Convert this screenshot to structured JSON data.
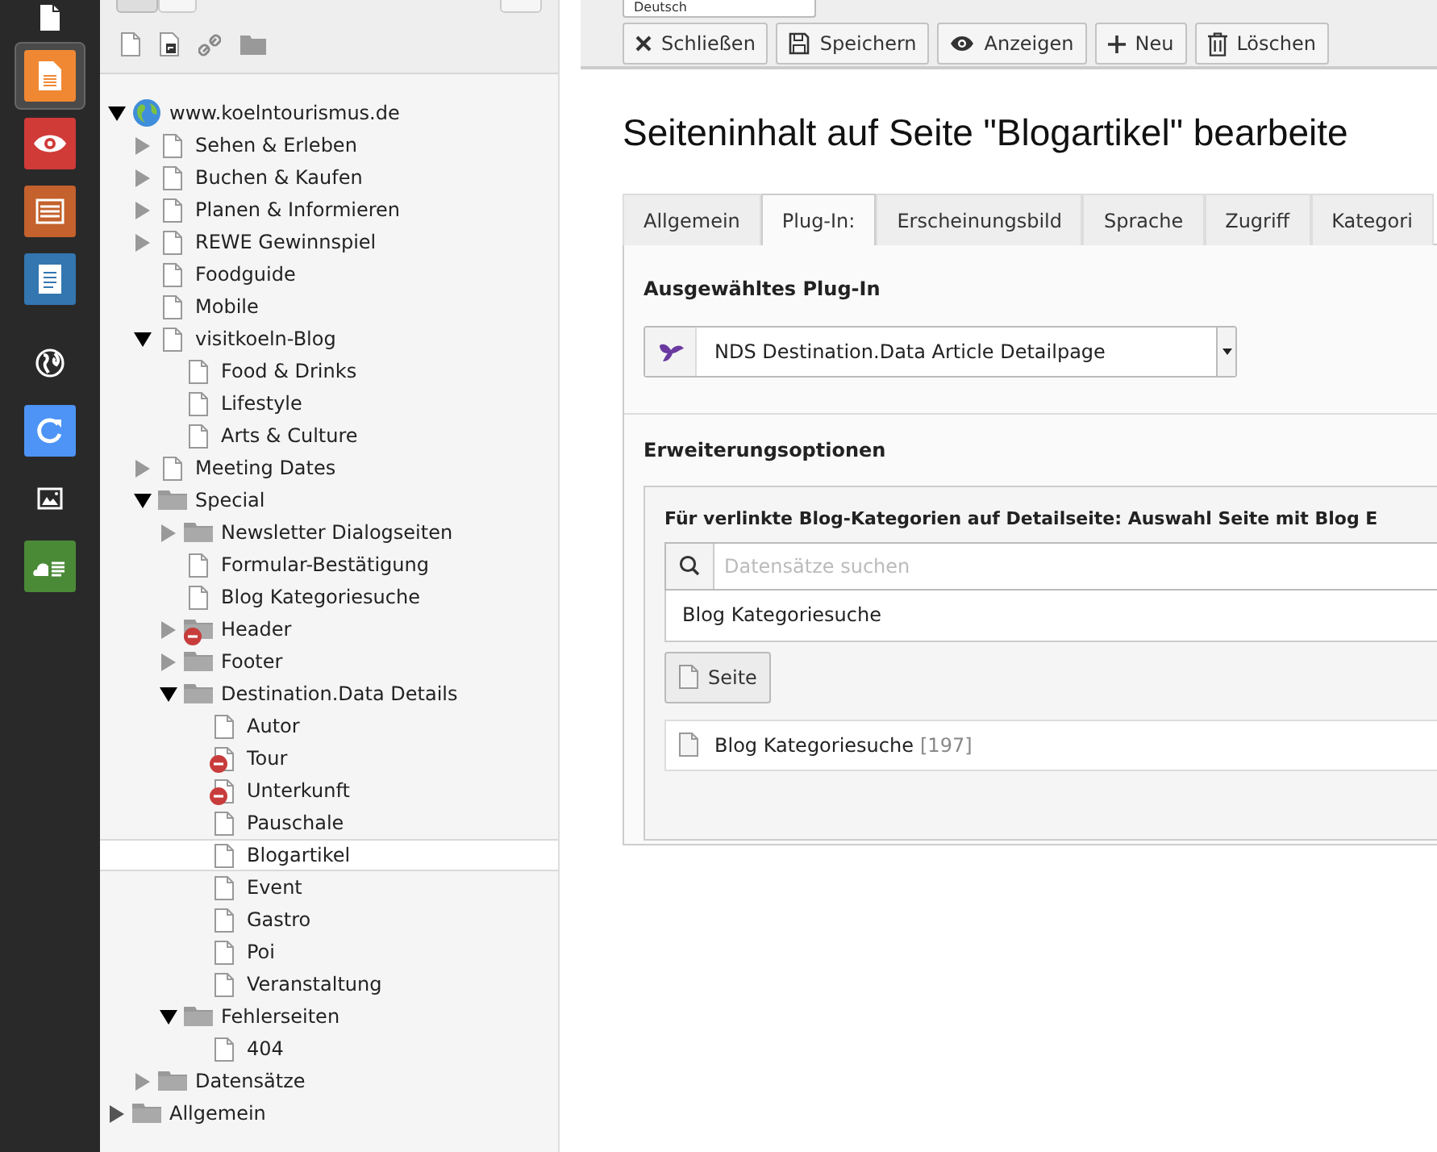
{
  "modules": [
    {
      "kind": "page",
      "selected": false
    },
    {
      "kind": "page-lines",
      "color": "#f08833",
      "selected": true
    },
    {
      "kind": "eye",
      "color": "#d03a37",
      "selected": false
    },
    {
      "kind": "list",
      "color": "#c4612d",
      "selected": false
    },
    {
      "kind": "document",
      "color": "#3376b0",
      "selected": false
    },
    {
      "kind": "globe",
      "selected": false
    },
    {
      "kind": "refresh",
      "color": "#4d94f6",
      "selected": false
    },
    {
      "kind": "image",
      "selected": false
    },
    {
      "kind": "cloud",
      "color": "#4a8a37",
      "selected": false
    }
  ],
  "tree": [
    {
      "label": "www.koelntourismus.de",
      "kind": "site",
      "expanded": true,
      "selected": false,
      "children": [
        {
          "label": "Sehen & Erleben",
          "kind": "page",
          "expanded": false,
          "selected": false
        },
        {
          "label": "Buchen & Kaufen",
          "kind": "page",
          "expanded": false,
          "selected": false
        },
        {
          "label": "Planen & Informieren",
          "kind": "page",
          "expanded": false,
          "selected": false
        },
        {
          "label": "REWE Gewinnspiel",
          "kind": "page",
          "expanded": false,
          "selected": false
        },
        {
          "label": "Foodguide",
          "kind": "page",
          "selected": false
        },
        {
          "label": "Mobile",
          "kind": "page",
          "selected": false
        },
        {
          "label": "visitkoeln-Blog",
          "kind": "page",
          "expanded": true,
          "selected": false,
          "children": [
            {
              "label": "Food & Drinks",
              "kind": "page",
              "selected": false
            },
            {
              "label": "Lifestyle",
              "kind": "page",
              "selected": false
            },
            {
              "label": "Arts & Culture",
              "kind": "page",
              "selected": false
            }
          ]
        },
        {
          "label": "Meeting Dates",
          "kind": "page",
          "expanded": false,
          "selected": false
        },
        {
          "label": "Special",
          "kind": "folder",
          "expanded": true,
          "selected": false,
          "children": [
            {
              "label": "Newsletter Dialogseiten",
              "kind": "folder",
              "expanded": false,
              "selected": false
            },
            {
              "label": "Formular-Bestätigung",
              "kind": "page",
              "selected": false
            },
            {
              "label": "Blog Kategoriesuche",
              "kind": "page",
              "selected": false
            },
            {
              "label": "Header",
              "kind": "folder",
              "expanded": false,
              "hidden": true,
              "selected": false
            },
            {
              "label": "Footer",
              "kind": "folder",
              "expanded": false,
              "selected": false
            },
            {
              "label": "Destination.Data Details",
              "kind": "folder",
              "expanded": true,
              "selected": false,
              "children": [
                {
                  "label": "Autor",
                  "kind": "page",
                  "selected": false
                },
                {
                  "label": "Tour",
                  "kind": "page",
                  "hidden": true,
                  "selected": false
                },
                {
                  "label": "Unterkunft",
                  "kind": "page",
                  "hidden": true,
                  "selected": false
                },
                {
                  "label": "Pauschale",
                  "kind": "page",
                  "selected": false
                },
                {
                  "label": "Blogartikel",
                  "kind": "page",
                  "selected": true
                },
                {
                  "label": "Event",
                  "kind": "page",
                  "selected": false
                },
                {
                  "label": "Gastro",
                  "kind": "page",
                  "selected": false
                },
                {
                  "label": "Poi",
                  "kind": "page",
                  "selected": false
                },
                {
                  "label": "Veranstaltung",
                  "kind": "page",
                  "selected": false
                }
              ]
            },
            {
              "label": "Fehlerseiten",
              "kind": "folder",
              "expanded": true,
              "selected": false,
              "children": [
                {
                  "label": "404",
                  "kind": "page",
                  "selected": false
                }
              ]
            }
          ]
        },
        {
          "label": "Datensätze",
          "kind": "folder",
          "expanded": false,
          "selected": false
        }
      ]
    },
    {
      "label": "Allgemein",
      "kind": "folder",
      "expanded": false,
      "selected": false
    }
  ],
  "language_select": {
    "value": "Deutsch"
  },
  "buttons": [
    {
      "label": "Schließen",
      "kind": "close"
    },
    {
      "label": "Speichern",
      "kind": "save"
    },
    {
      "label": "Anzeigen",
      "kind": "view"
    },
    {
      "label": "Neu",
      "kind": "new"
    },
    {
      "label": "Löschen",
      "kind": "delete"
    }
  ],
  "heading": "Seiteninhalt auf Seite \"Blogartikel\" bearbeite",
  "tabs": [
    {
      "label": "Allgemein",
      "selected": false
    },
    {
      "label": "Plug-In:",
      "selected": true
    },
    {
      "label": "Erscheinungsbild",
      "selected": false
    },
    {
      "label": "Sprache",
      "selected": false
    },
    {
      "label": "Zugriff",
      "selected": false
    },
    {
      "label": "Kategori",
      "selected": false
    }
  ],
  "plugin": {
    "title": "Ausgewähltes Plug-In",
    "value": "NDS Destination.Data Article Detailpage"
  },
  "options": {
    "title": "Erweiterungsoptionen",
    "field_label": "Für verlinkte Blog-Kategorien auf Detailseite: Auswahl Seite mit Blog E",
    "search": {
      "placeholder": "Datensätze suchen"
    },
    "result": "Blog Kategoriesuche",
    "page_button": "Seite",
    "selected_item": {
      "label": "Blog Kategoriesuche",
      "uid": "[197]"
    }
  }
}
